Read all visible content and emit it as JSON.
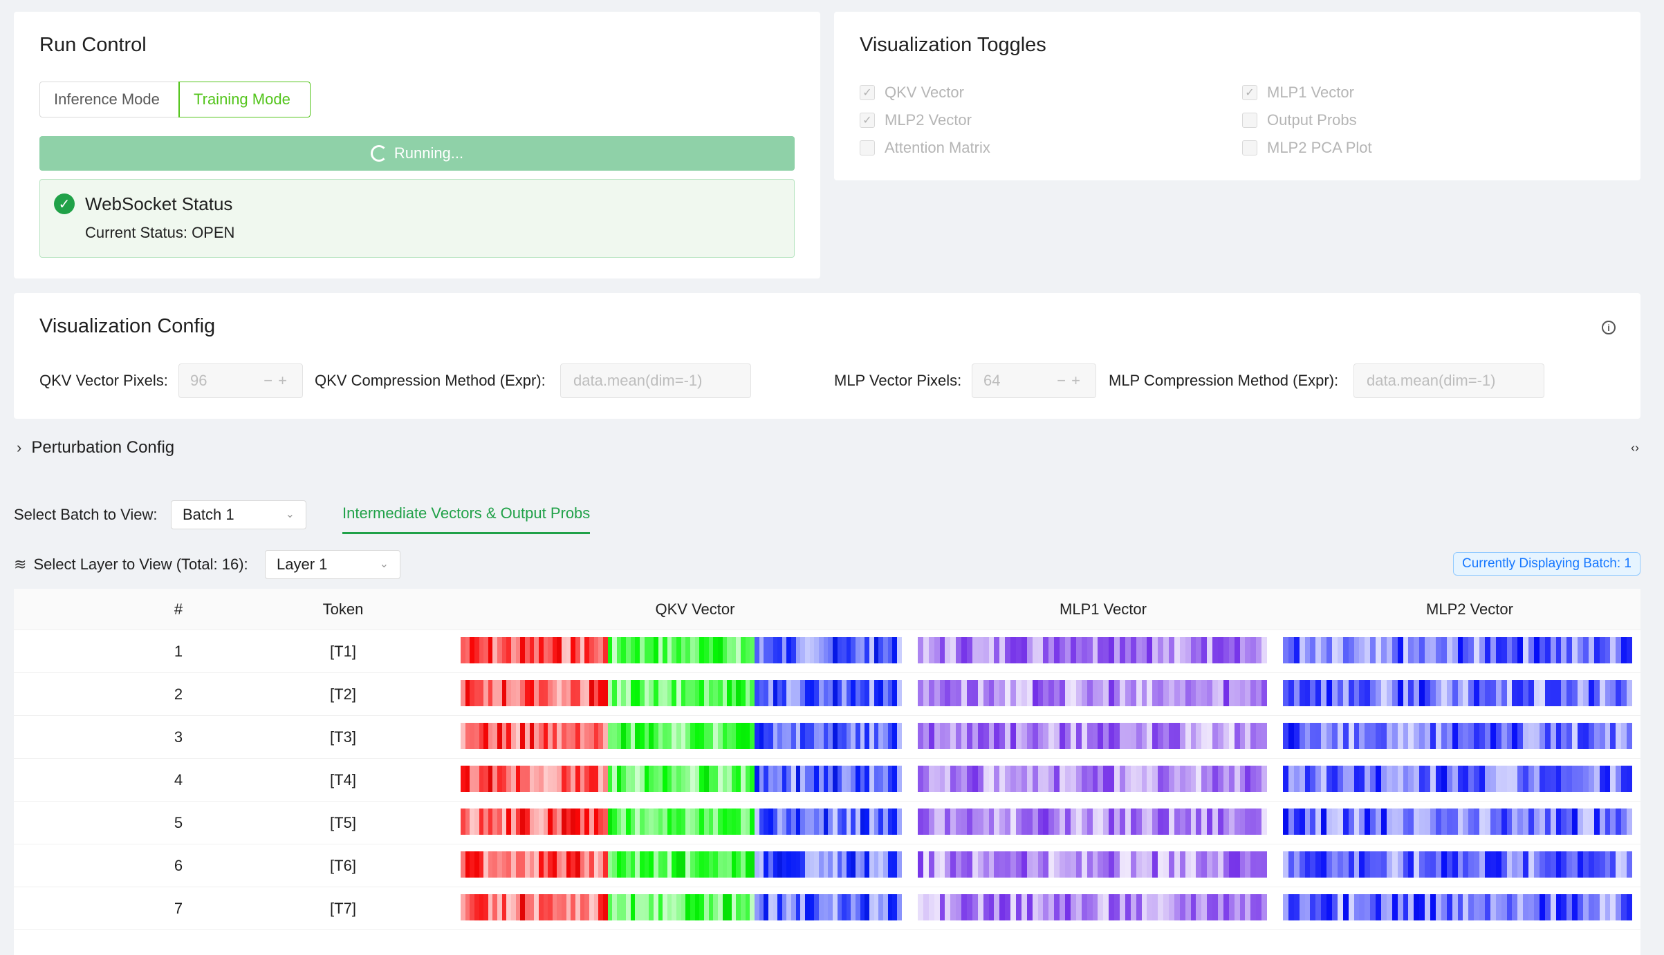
{
  "run_control": {
    "title": "Run Control",
    "modes": [
      "Inference Mode",
      "Training Mode"
    ],
    "active_mode": "Training Mode",
    "running_label": "Running...",
    "ws_title": "WebSocket Status",
    "ws_status": "Current Status: OPEN"
  },
  "toggles": {
    "title": "Visualization Toggles",
    "items": [
      {
        "label": "QKV Vector",
        "checked": true
      },
      {
        "label": "MLP1 Vector",
        "checked": true
      },
      {
        "label": "MLP2 Vector",
        "checked": true
      },
      {
        "label": "Output Probs",
        "checked": false
      },
      {
        "label": "Attention Matrix",
        "checked": false
      },
      {
        "label": "MLP2 PCA Plot",
        "checked": false
      }
    ]
  },
  "config": {
    "title": "Visualization Config",
    "qkv_pixels_label": "QKV Vector Pixels:",
    "qkv_pixels_value": "96",
    "qkv_method_label": "QKV Compression Method (Expr):",
    "qkv_method_placeholder": "data.mean(dim=-1)",
    "mlp_pixels_label": "MLP Vector Pixels:",
    "mlp_pixels_value": "64",
    "mlp_method_label": "MLP Compression Method (Expr):",
    "mlp_method_placeholder": "data.mean(dim=-1)"
  },
  "perturbation": {
    "label": "Perturbation Config"
  },
  "batch": {
    "label": "Select Batch to View:",
    "value": "Batch 1",
    "tab": "Intermediate Vectors & Output Probs"
  },
  "layer": {
    "label": "Select Layer to View (Total: 16):",
    "value": "Layer 1",
    "badge": "Currently Displaying Batch: 1"
  },
  "table": {
    "headers": [
      "#",
      "Token",
      "QKV Vector",
      "MLP1 Vector",
      "MLP2 Vector"
    ],
    "rows": [
      {
        "index": "1",
        "token": "[T1]"
      },
      {
        "index": "2",
        "token": "[T2]"
      },
      {
        "index": "3",
        "token": "[T3]"
      },
      {
        "index": "4",
        "token": "[T4]"
      },
      {
        "index": "5",
        "token": "[T5]"
      },
      {
        "index": "6",
        "token": "[T6]"
      },
      {
        "index": "7",
        "token": "[T7]"
      }
    ]
  }
}
